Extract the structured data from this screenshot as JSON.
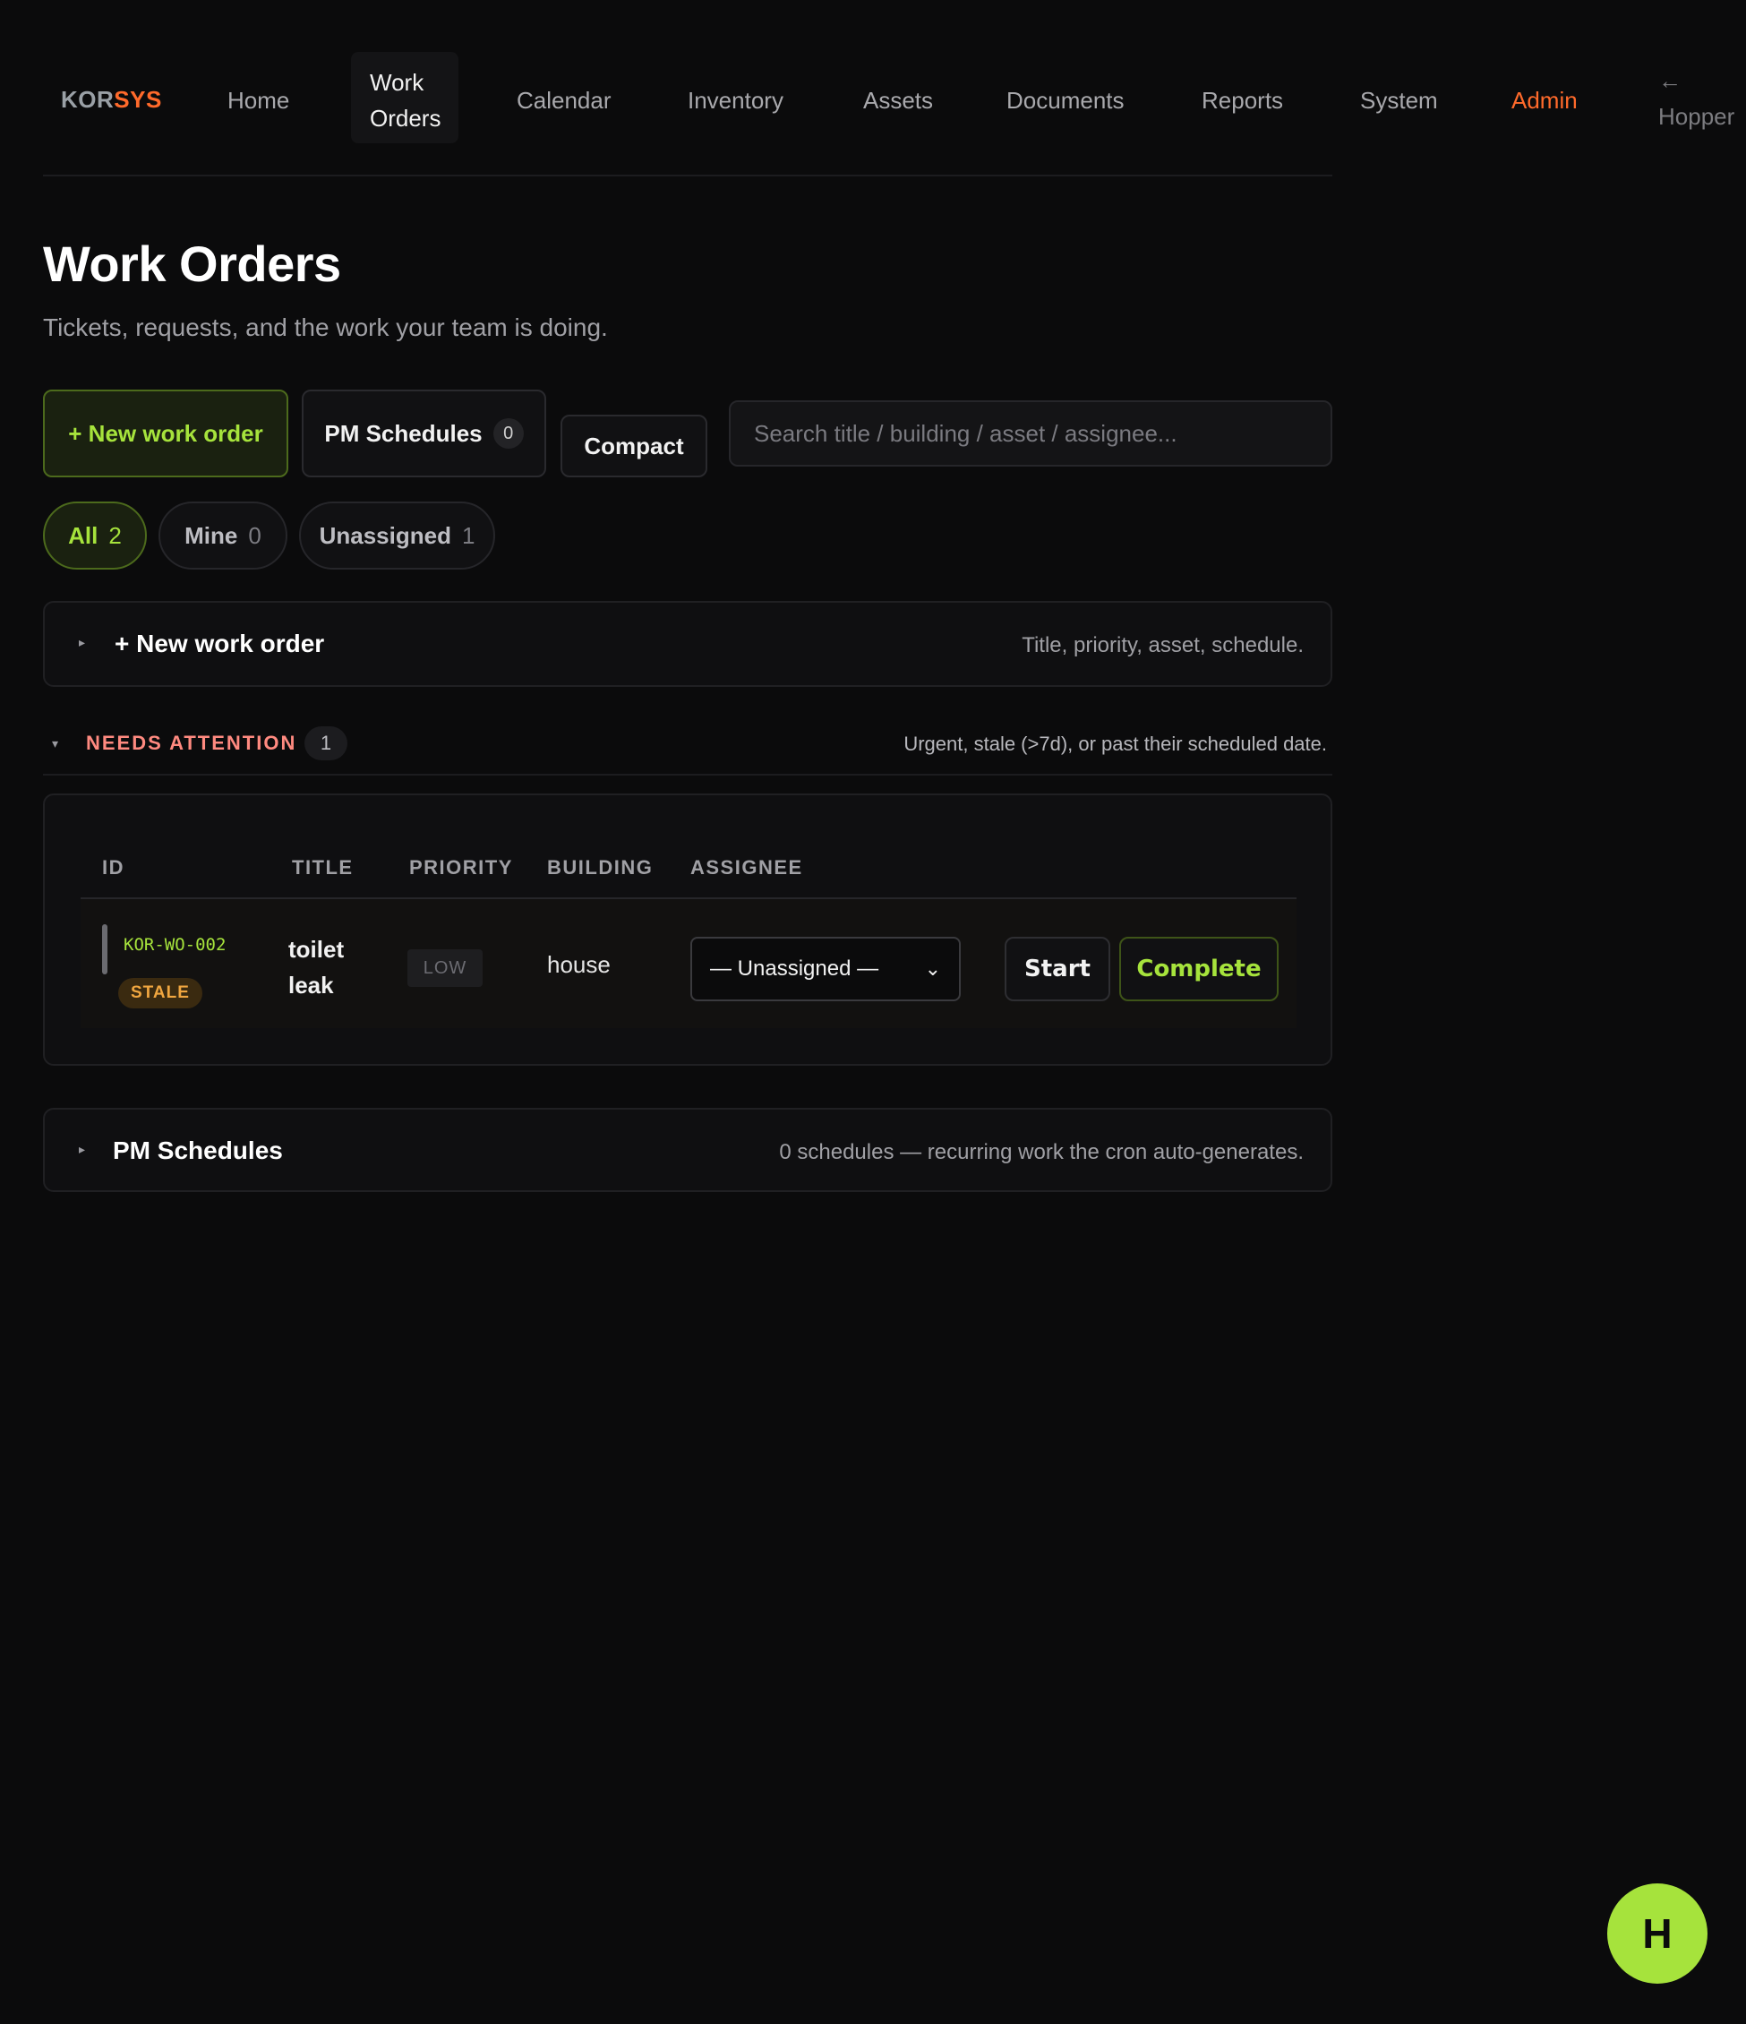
{
  "nav": {
    "logo_a": "KOR",
    "logo_b": "SYS",
    "items": [
      {
        "label": "Home"
      },
      {
        "label": "Work Orders"
      },
      {
        "label": "Calendar"
      },
      {
        "label": "Inventory"
      },
      {
        "label": "Assets"
      },
      {
        "label": "Documents"
      },
      {
        "label": "Reports"
      },
      {
        "label": "System"
      },
      {
        "label": "Admin"
      },
      {
        "label": "← Hopper"
      }
    ],
    "active": "Work Orders"
  },
  "header": {
    "title": "Work Orders",
    "subtitle": "Tickets, requests, and the work your team is doing."
  },
  "toolbar": {
    "new_label": "+ New work order",
    "pm_label": "PM Schedules",
    "pm_count": "0",
    "compact_label": "Compact",
    "search_placeholder": "Search title / building / asset / assignee..."
  },
  "filters": [
    {
      "label": "All",
      "count": "2",
      "active": true
    },
    {
      "label": "Mine",
      "count": "0"
    },
    {
      "label": "Unassigned",
      "count": "1"
    }
  ],
  "new_panel": {
    "title": "+ New work order",
    "hint": "Title, priority, asset, schedule."
  },
  "needs_attention": {
    "title": "NEEDS ATTENTION",
    "count": "1",
    "hint": "Urgent, stale (>7d), or past their scheduled date.",
    "columns": [
      "ID",
      "TITLE",
      "PRIORITY",
      "BUILDING",
      "ASSIGNEE"
    ],
    "rows": [
      {
        "id": "KOR-WO-002",
        "badge": "STALE",
        "title": "toilet leak",
        "priority": "LOW",
        "building": "house",
        "assignee": "— Unassigned —",
        "start_label": "Start",
        "complete_label": "Complete"
      }
    ]
  },
  "pm_panel": {
    "title": "PM Schedules",
    "hint": "0 schedules — recurring work the cron auto-generates."
  },
  "user": {
    "initial": "H"
  },
  "colors": {
    "accent": "#a6e33c",
    "admin": "#ff6a2b",
    "attention": "#ff8a80",
    "stale": "#f0a640",
    "background": "#0b0b0c"
  }
}
